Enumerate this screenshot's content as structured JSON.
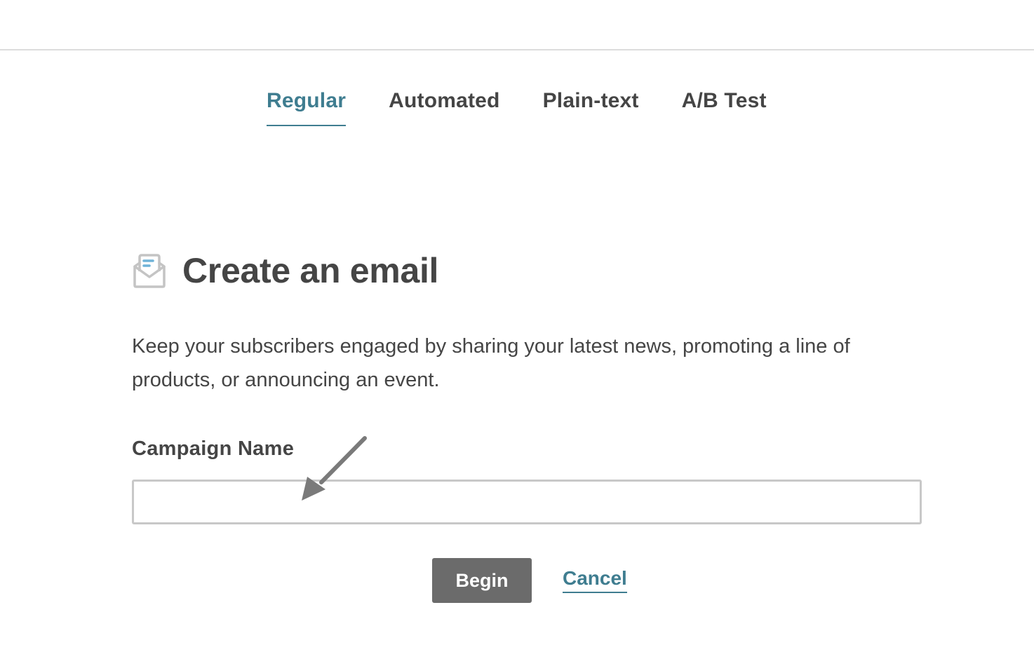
{
  "tabs": [
    {
      "label": "Regular",
      "active": true
    },
    {
      "label": "Automated",
      "active": false
    },
    {
      "label": "Plain-text",
      "active": false
    },
    {
      "label": "A/B Test",
      "active": false
    }
  ],
  "header": {
    "icon": "open-envelope-icon",
    "title": "Create an email"
  },
  "description": "Keep your subscribers engaged by sharing your latest news, promoting a line of products, or announcing an event.",
  "form": {
    "campaign_name_label": "Campaign Name",
    "campaign_name_value": "",
    "campaign_name_placeholder": ""
  },
  "actions": {
    "begin_label": "Begin",
    "cancel_label": "Cancel"
  },
  "annotation": {
    "icon": "pointer-arrow-icon"
  },
  "colors": {
    "accent": "#3f7d90",
    "text": "#454545",
    "button": "#6b6b6b",
    "input_border": "#c8c8c8"
  }
}
